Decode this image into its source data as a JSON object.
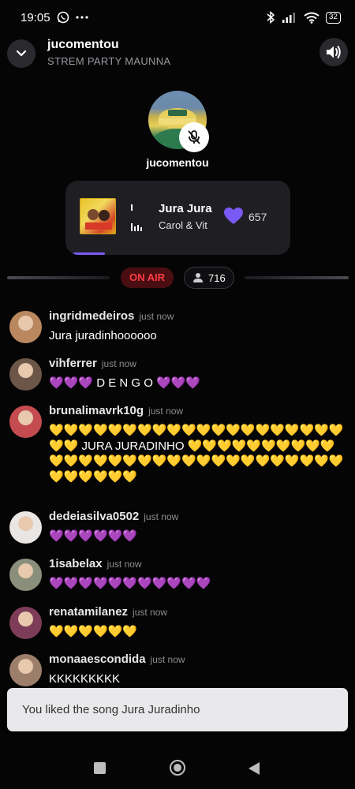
{
  "status_bar": {
    "time": "19:05",
    "battery": "32",
    "icons": [
      "whatsapp-icon",
      "more-dots-icon",
      "bluetooth-icon",
      "signal-icon",
      "wifi-icon",
      "battery-icon"
    ]
  },
  "header": {
    "title": "jucomentou",
    "subtitle": "STREM PARTY MAUNNA"
  },
  "host": {
    "name": "jucomentou",
    "muted": true
  },
  "now_playing": {
    "title": "Jura Jura",
    "artist": "Carol & Vit",
    "likes": "657"
  },
  "live": {
    "on_air_label": "ON AIR",
    "listeners": "716"
  },
  "chat": {
    "messages": [
      {
        "user": "ingridmedeiros",
        "time": "just now",
        "text": "Jura juradinhoooooo",
        "avatar": "#b9885f"
      },
      {
        "user": "vihferrer",
        "time": "just now",
        "text": "💜💜💜 D E N G O 💜💜💜",
        "avatar": "#6b5648"
      },
      {
        "user": "brunalimavrk10g",
        "time": "just now",
        "text": "💛💛💛💛💛💛💛💛💛💛💛💛💛💛💛💛💛💛💛💛💛💛 JURA JURADINHO 💛💛💛💛💛💛💛💛💛💛💛💛💛💛💛💛💛💛💛💛💛💛💛💛💛💛💛💛💛💛💛💛💛💛💛💛",
        "avatar": "#c44b4f"
      },
      {
        "user": "dedeiasilva0502",
        "time": "just now",
        "text": "💜💜💜💜💜💜",
        "avatar": "#e9e6e4"
      },
      {
        "user": "1isabelax",
        "time": "just now",
        "text": "💜💜💜💜💜💜💜💜💜💜💜",
        "avatar": "#8a8f7b"
      },
      {
        "user": "renatamilanez",
        "time": "just now",
        "text": "💛💛💛💛💛💛",
        "avatar": "#7d3c57"
      },
      {
        "user": "monaaescondida",
        "time": "just now",
        "text": "KKKKKKKKK",
        "avatar": "#9c7e6a"
      }
    ]
  },
  "toast": {
    "message": "You liked the song Jura Juradinho"
  },
  "colors": {
    "accent": "#7a5af5",
    "on_air": "#ff3c44",
    "background": "#050506"
  }
}
